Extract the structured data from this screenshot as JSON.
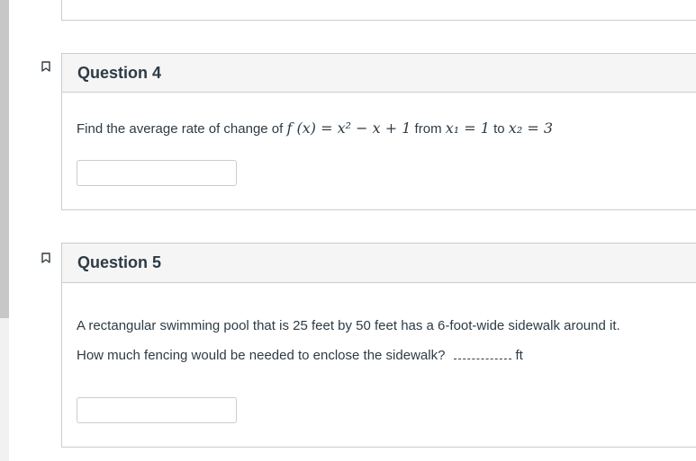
{
  "questions": [
    {
      "title": "Question 4",
      "prompt_prefix": "Find the average rate of change of ",
      "function_expr": "f (x) = x² − x + 1",
      "from_label": " from ",
      "x1_expr": "x₁ = 1",
      "to_label": " to ",
      "x2_expr": "x₂ = 3",
      "answer_value": ""
    },
    {
      "title": "Question 5",
      "line1": "A rectangular swimming pool that is 25 feet by 50 feet has a 6-foot-wide sidewalk around it.",
      "line2": "How much fencing would be needed to enclose the sidewalk?",
      "unit": "ft",
      "answer_value": ""
    }
  ],
  "icons": {
    "flag": "flag-question-icon"
  },
  "colors": {
    "text": "#2d3b45",
    "header_bg": "#f5f5f5",
    "border": "#c7cdd1"
  }
}
